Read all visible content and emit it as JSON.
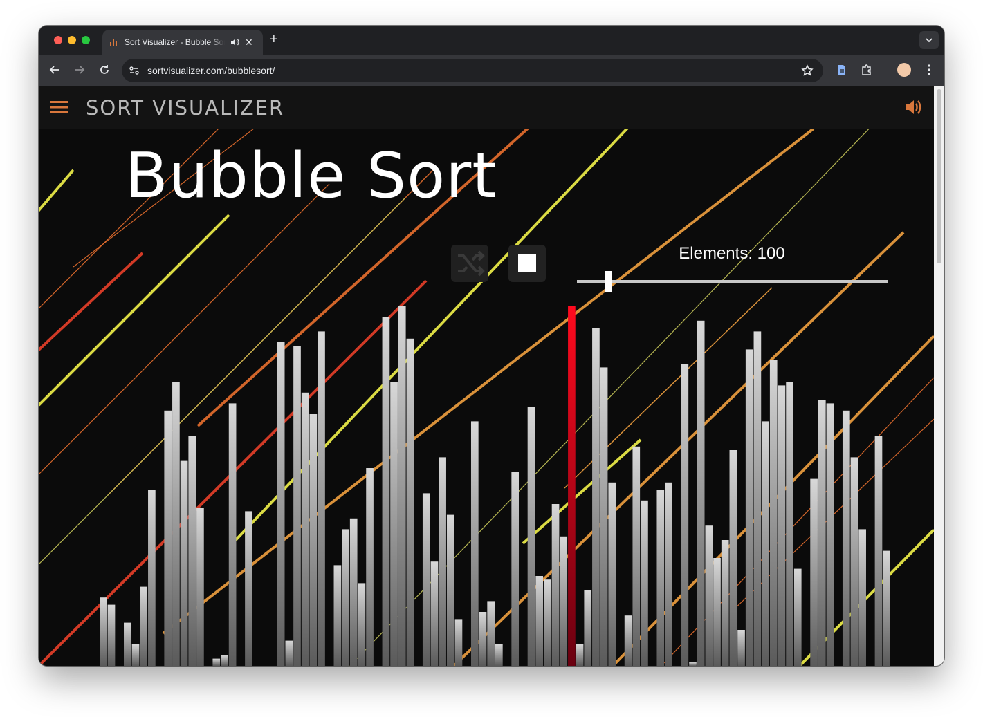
{
  "browser": {
    "tab_title": "Sort Visualizer - Bubble Sort",
    "url": "sortvisualizer.com/bubblesort/",
    "accent": "#e8eaed"
  },
  "app": {
    "brand": "SORT VISUALIZER",
    "accent": "#d9773c"
  },
  "main": {
    "title": "Bubble Sort",
    "elements_label": "Elements: 100",
    "elements_count": 100,
    "slider_fraction": 0.1
  },
  "visualization": {
    "active_bar_color": "#e8001c",
    "active_bar_index": 58,
    "values": [
      0.19,
      0.17,
      0,
      0.12,
      0.06,
      0.22,
      0.49,
      0,
      0.71,
      0.79,
      0.57,
      0.64,
      0.44,
      0,
      0.02,
      0.03,
      0.73,
      0,
      0.43,
      0,
      0,
      0,
      0.9,
      0.07,
      0.89,
      0.76,
      0.7,
      0.93,
      0,
      0.28,
      0.38,
      0.41,
      0.23,
      0.55,
      0,
      0.97,
      0.79,
      1.0,
      0.91,
      0,
      0.48,
      0.29,
      0.58,
      0.42,
      0.13,
      0,
      0.68,
      0.15,
      0.18,
      0.06,
      0,
      0.54,
      0,
      0.72,
      0.25,
      0.24,
      0.45,
      0.36,
      1.0,
      0.06,
      0.21,
      0.94,
      0.83,
      0.51,
      0,
      0.14,
      0.61,
      0.46,
      0,
      0.49,
      0.51,
      0,
      0.84,
      0.01,
      0.96,
      0.39,
      0.3,
      0.35,
      0.6,
      0.1,
      0.88,
      0.93,
      0.68,
      0.85,
      0.78,
      0.79,
      0.27,
      0,
      0.52,
      0.74,
      0.73,
      0,
      0.71,
      0.58,
      0.38,
      0
    ],
    "values_tail": [
      0.64,
      0.32
    ]
  }
}
